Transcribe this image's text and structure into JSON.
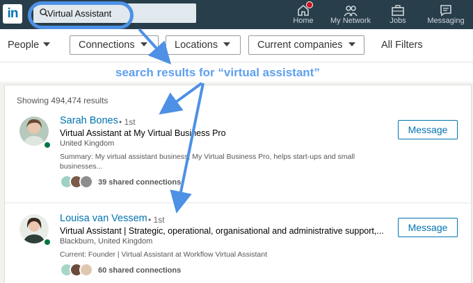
{
  "nav": {
    "logo_text": "in",
    "search_value": "Virtual Assistant",
    "items": [
      {
        "label": "Home",
        "icon": "home-icon"
      },
      {
        "label": "My Network",
        "icon": "network-icon"
      },
      {
        "label": "Jobs",
        "icon": "briefcase-icon"
      },
      {
        "label": "Messaging",
        "icon": "messaging-icon"
      }
    ]
  },
  "filters": {
    "people": "People",
    "buttons": [
      "Connections",
      "Locations",
      "Current companies"
    ],
    "all": "All Filters"
  },
  "annotation": "search results for “virtual assistant”",
  "results": {
    "showing": "Showing 494,474 results",
    "items": [
      {
        "name": "Sarah Bones",
        "degree": "• 1st",
        "headline": "Virtual Assistant at My Virtual Business Pro",
        "location": "United Kingdom",
        "summary_line1": "Summary: My virtual assistant business, My Virtual Business Pro, helps start-ups and small",
        "summary_line2": "businesses...",
        "shared": "39 shared connections",
        "action": "Message"
      },
      {
        "name": "Louisa van Vessem",
        "degree": "• 1st",
        "headline": "Virtual Assistant | Strategic, operational, organisational and administrative support,...",
        "location": "Blackburn, United Kingdom",
        "summary_line1": "Current: Founder | Virtual Assistant at Workflow Virtual Assistant",
        "shared": "60 shared connections",
        "action": "Message"
      }
    ]
  },
  "colors": {
    "nav_bg": "#283e4a",
    "link": "#0073b1",
    "annotation": "#5ea0ee",
    "online": "#057642"
  }
}
